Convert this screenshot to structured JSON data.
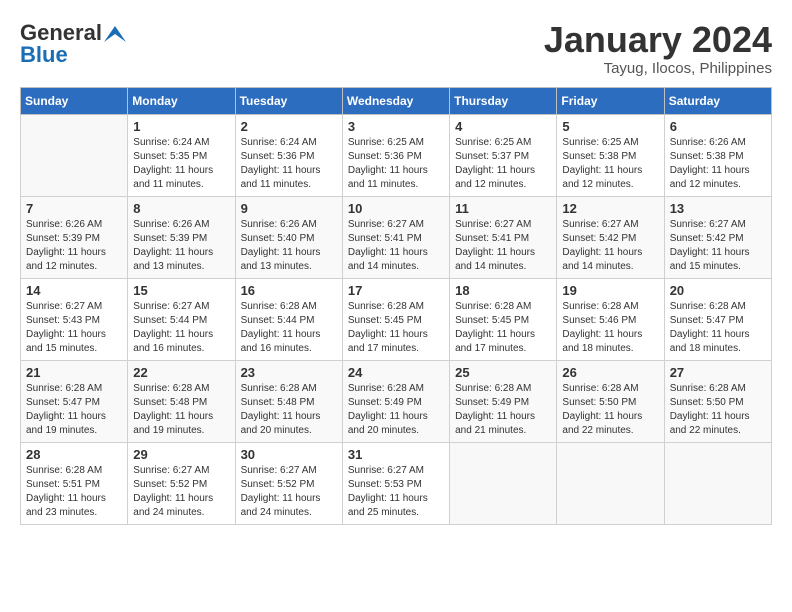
{
  "header": {
    "logo_line1": "General",
    "logo_line2": "Blue",
    "month": "January 2024",
    "location": "Tayug, Ilocos, Philippines"
  },
  "weekdays": [
    "Sunday",
    "Monday",
    "Tuesday",
    "Wednesday",
    "Thursday",
    "Friday",
    "Saturday"
  ],
  "weeks": [
    [
      {
        "day": null
      },
      {
        "day": "1",
        "sunrise": "Sunrise: 6:24 AM",
        "sunset": "Sunset: 5:35 PM",
        "daylight": "Daylight: 11 hours and 11 minutes."
      },
      {
        "day": "2",
        "sunrise": "Sunrise: 6:24 AM",
        "sunset": "Sunset: 5:36 PM",
        "daylight": "Daylight: 11 hours and 11 minutes."
      },
      {
        "day": "3",
        "sunrise": "Sunrise: 6:25 AM",
        "sunset": "Sunset: 5:36 PM",
        "daylight": "Daylight: 11 hours and 11 minutes."
      },
      {
        "day": "4",
        "sunrise": "Sunrise: 6:25 AM",
        "sunset": "Sunset: 5:37 PM",
        "daylight": "Daylight: 11 hours and 12 minutes."
      },
      {
        "day": "5",
        "sunrise": "Sunrise: 6:25 AM",
        "sunset": "Sunset: 5:38 PM",
        "daylight": "Daylight: 11 hours and 12 minutes."
      },
      {
        "day": "6",
        "sunrise": "Sunrise: 6:26 AM",
        "sunset": "Sunset: 5:38 PM",
        "daylight": "Daylight: 11 hours and 12 minutes."
      }
    ],
    [
      {
        "day": "7",
        "sunrise": "Sunrise: 6:26 AM",
        "sunset": "Sunset: 5:39 PM",
        "daylight": "Daylight: 11 hours and 12 minutes."
      },
      {
        "day": "8",
        "sunrise": "Sunrise: 6:26 AM",
        "sunset": "Sunset: 5:39 PM",
        "daylight": "Daylight: 11 hours and 13 minutes."
      },
      {
        "day": "9",
        "sunrise": "Sunrise: 6:26 AM",
        "sunset": "Sunset: 5:40 PM",
        "daylight": "Daylight: 11 hours and 13 minutes."
      },
      {
        "day": "10",
        "sunrise": "Sunrise: 6:27 AM",
        "sunset": "Sunset: 5:41 PM",
        "daylight": "Daylight: 11 hours and 14 minutes."
      },
      {
        "day": "11",
        "sunrise": "Sunrise: 6:27 AM",
        "sunset": "Sunset: 5:41 PM",
        "daylight": "Daylight: 11 hours and 14 minutes."
      },
      {
        "day": "12",
        "sunrise": "Sunrise: 6:27 AM",
        "sunset": "Sunset: 5:42 PM",
        "daylight": "Daylight: 11 hours and 14 minutes."
      },
      {
        "day": "13",
        "sunrise": "Sunrise: 6:27 AM",
        "sunset": "Sunset: 5:42 PM",
        "daylight": "Daylight: 11 hours and 15 minutes."
      }
    ],
    [
      {
        "day": "14",
        "sunrise": "Sunrise: 6:27 AM",
        "sunset": "Sunset: 5:43 PM",
        "daylight": "Daylight: 11 hours and 15 minutes."
      },
      {
        "day": "15",
        "sunrise": "Sunrise: 6:27 AM",
        "sunset": "Sunset: 5:44 PM",
        "daylight": "Daylight: 11 hours and 16 minutes."
      },
      {
        "day": "16",
        "sunrise": "Sunrise: 6:28 AM",
        "sunset": "Sunset: 5:44 PM",
        "daylight": "Daylight: 11 hours and 16 minutes."
      },
      {
        "day": "17",
        "sunrise": "Sunrise: 6:28 AM",
        "sunset": "Sunset: 5:45 PM",
        "daylight": "Daylight: 11 hours and 17 minutes."
      },
      {
        "day": "18",
        "sunrise": "Sunrise: 6:28 AM",
        "sunset": "Sunset: 5:45 PM",
        "daylight": "Daylight: 11 hours and 17 minutes."
      },
      {
        "day": "19",
        "sunrise": "Sunrise: 6:28 AM",
        "sunset": "Sunset: 5:46 PM",
        "daylight": "Daylight: 11 hours and 18 minutes."
      },
      {
        "day": "20",
        "sunrise": "Sunrise: 6:28 AM",
        "sunset": "Sunset: 5:47 PM",
        "daylight": "Daylight: 11 hours and 18 minutes."
      }
    ],
    [
      {
        "day": "21",
        "sunrise": "Sunrise: 6:28 AM",
        "sunset": "Sunset: 5:47 PM",
        "daylight": "Daylight: 11 hours and 19 minutes."
      },
      {
        "day": "22",
        "sunrise": "Sunrise: 6:28 AM",
        "sunset": "Sunset: 5:48 PM",
        "daylight": "Daylight: 11 hours and 19 minutes."
      },
      {
        "day": "23",
        "sunrise": "Sunrise: 6:28 AM",
        "sunset": "Sunset: 5:48 PM",
        "daylight": "Daylight: 11 hours and 20 minutes."
      },
      {
        "day": "24",
        "sunrise": "Sunrise: 6:28 AM",
        "sunset": "Sunset: 5:49 PM",
        "daylight": "Daylight: 11 hours and 20 minutes."
      },
      {
        "day": "25",
        "sunrise": "Sunrise: 6:28 AM",
        "sunset": "Sunset: 5:49 PM",
        "daylight": "Daylight: 11 hours and 21 minutes."
      },
      {
        "day": "26",
        "sunrise": "Sunrise: 6:28 AM",
        "sunset": "Sunset: 5:50 PM",
        "daylight": "Daylight: 11 hours and 22 minutes."
      },
      {
        "day": "27",
        "sunrise": "Sunrise: 6:28 AM",
        "sunset": "Sunset: 5:50 PM",
        "daylight": "Daylight: 11 hours and 22 minutes."
      }
    ],
    [
      {
        "day": "28",
        "sunrise": "Sunrise: 6:28 AM",
        "sunset": "Sunset: 5:51 PM",
        "daylight": "Daylight: 11 hours and 23 minutes."
      },
      {
        "day": "29",
        "sunrise": "Sunrise: 6:27 AM",
        "sunset": "Sunset: 5:52 PM",
        "daylight": "Daylight: 11 hours and 24 minutes."
      },
      {
        "day": "30",
        "sunrise": "Sunrise: 6:27 AM",
        "sunset": "Sunset: 5:52 PM",
        "daylight": "Daylight: 11 hours and 24 minutes."
      },
      {
        "day": "31",
        "sunrise": "Sunrise: 6:27 AM",
        "sunset": "Sunset: 5:53 PM",
        "daylight": "Daylight: 11 hours and 25 minutes."
      },
      {
        "day": null
      },
      {
        "day": null
      },
      {
        "day": null
      }
    ]
  ]
}
